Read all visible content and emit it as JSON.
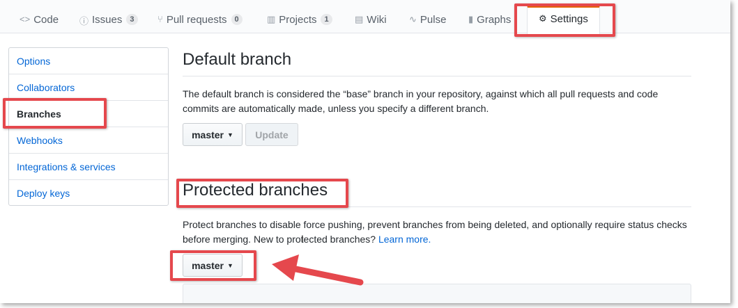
{
  "tabs": [
    {
      "icon": "<>",
      "label": "Code"
    },
    {
      "icon": "ⓘ",
      "label": "Issues",
      "count": "3"
    },
    {
      "icon": "⑂",
      "label": "Pull requests",
      "count": "0"
    },
    {
      "icon": "▥",
      "label": "Projects",
      "count": "1"
    },
    {
      "icon": "▤",
      "label": "Wiki"
    },
    {
      "icon": "∿",
      "label": "Pulse"
    },
    {
      "icon": "▮",
      "label": "Graphs"
    },
    {
      "icon": "⚙",
      "label": "Settings"
    }
  ],
  "sidebar": {
    "items": [
      {
        "label": "Options"
      },
      {
        "label": "Collaborators"
      },
      {
        "label": "Branches"
      },
      {
        "label": "Webhooks"
      },
      {
        "label": "Integrations & services"
      },
      {
        "label": "Deploy keys"
      }
    ]
  },
  "default_branch": {
    "heading": "Default branch",
    "description": "The default branch is considered the “base” branch in your repository, against which all pull requests and code commits are automatically made, unless you specify a different branch.",
    "branch_select": "master",
    "update_button": "Update"
  },
  "protected_branches": {
    "heading": "Protected branches",
    "description": "Protect branches to disable force pushing, prevent branches from being deleted, and optionally require status checks before merging. New to protected branches?",
    "learn_more": "Learn more.",
    "branch_select": "master"
  },
  "colors": {
    "accent": "#0366d6",
    "annotation": "#e5484d",
    "selected_tab_border": "#e36209"
  }
}
